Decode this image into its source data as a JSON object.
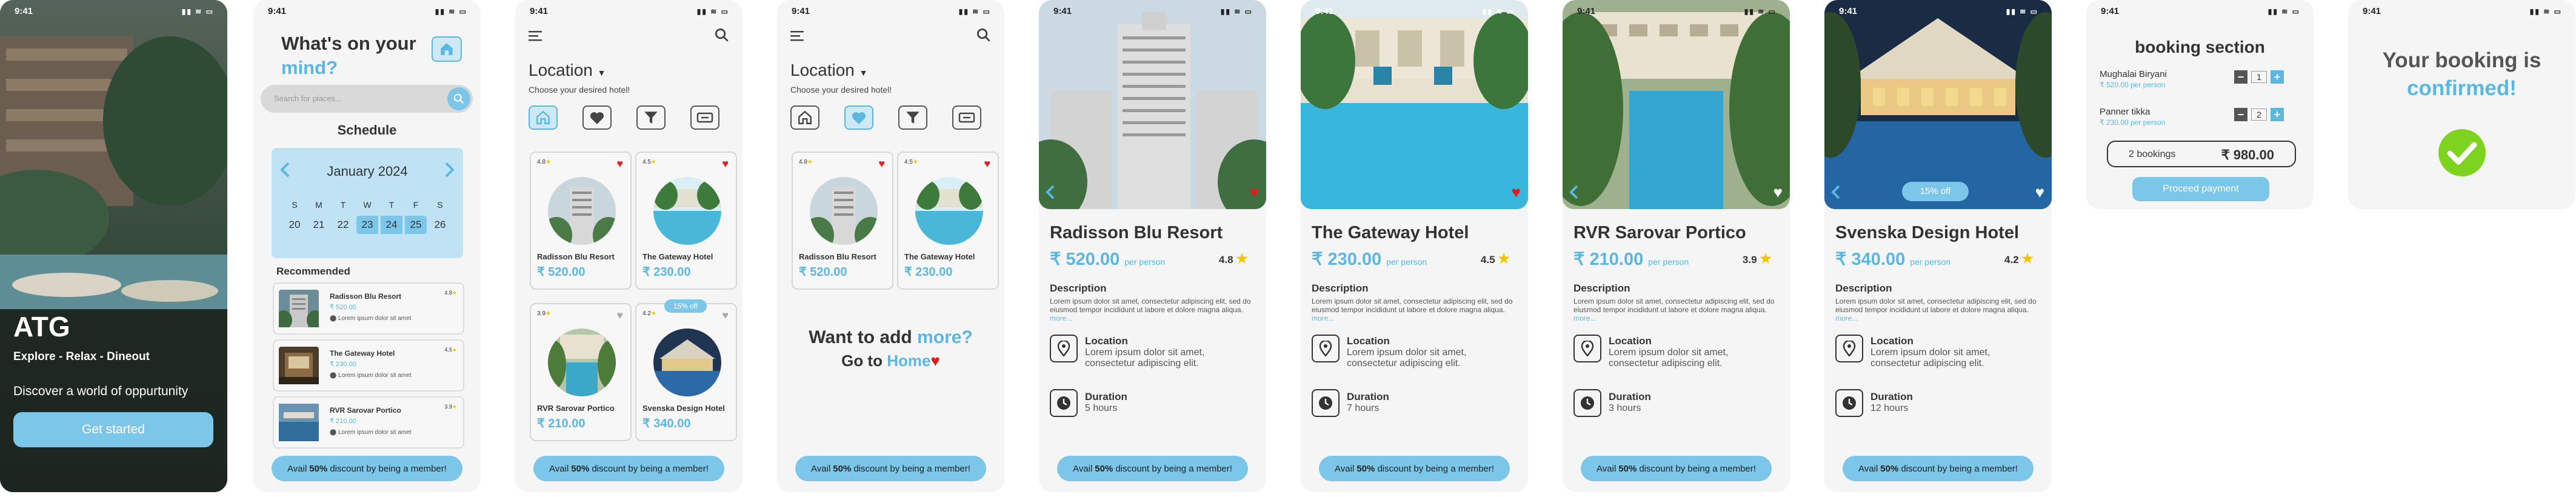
{
  "status_time": "9:41",
  "colors": {
    "accent": "#7cc6ea",
    "accent_text": "#5bb6e0",
    "heart": "#e21b1b",
    "star": "#f2c500",
    "check": "#7ed321"
  },
  "s1": {
    "title": "ATG",
    "tagline": "Explore - Relax - Dineout",
    "subtitle": "Discover a world of oppurtunity",
    "button": "Get started"
  },
  "s2": {
    "headline1": "What's on your",
    "headline2": "mind?",
    "search_placeholder": "Search for places...",
    "schedule": "Schedule",
    "month": "January 2024",
    "weekdays": [
      "S",
      "M",
      "T",
      "W",
      "T",
      "F",
      "S"
    ],
    "days": [
      "20",
      "21",
      "22",
      "23",
      "24",
      "25",
      "26"
    ],
    "recommended": "Recommended",
    "items": [
      {
        "name": "Radisson Blu Resort",
        "price": "₹ 520.00",
        "addr": "Lorem ipsum dolor sit amet",
        "rating": "4.8"
      },
      {
        "name": "The Gateway Hotel",
        "price": "₹ 230.00",
        "addr": "Lorem ipsum dolor sit amet",
        "rating": "4.5"
      },
      {
        "name": "RVR Sarovar Portico",
        "price": "₹ 210.00",
        "addr": "Lorem ipsum dolor sit amet",
        "rating": "3.9"
      }
    ],
    "discount": {
      "pre": "Avail",
      "bold": "50%",
      "post": "discount by being a member!"
    }
  },
  "s3": {
    "location": "Location",
    "choose": "Choose your desired hotel!",
    "cards": [
      {
        "name": "Radisson Blu Resort",
        "price": "₹ 520.00",
        "rating": "4.8"
      },
      {
        "name": "The Gateway Hotel",
        "price": "₹ 230.00",
        "rating": "4.5"
      },
      {
        "name": "RVR Sarovar Portico",
        "price": "₹ 210.00",
        "rating": "3.9"
      },
      {
        "name": "Svenska Design Hotel",
        "price": "₹ 340.00",
        "rating": "4.2",
        "badge": "15% off"
      }
    ]
  },
  "s4": {
    "cards": [
      {
        "name": "Radisson Blu Resort",
        "price": "₹ 520.00",
        "rating": "4.8"
      },
      {
        "name": "The Gateway Hotel",
        "price": "₹ 230.00",
        "rating": "4.5"
      }
    ],
    "want1": "Want to add",
    "want2": "more?",
    "goto1": "Go to",
    "goto2": "Home"
  },
  "details": [
    {
      "name": "Radisson Blu Resort",
      "price": "₹ 520.00",
      "per": "per person",
      "rating": "4.8",
      "duration": "5 hours",
      "liked": true,
      "badge": ""
    },
    {
      "name": "The Gateway Hotel",
      "price": "₹ 230.00",
      "per": "per person",
      "rating": "4.5",
      "duration": "7 hours",
      "liked": true,
      "badge": ""
    },
    {
      "name": "RVR Sarovar Portico",
      "price": "₹ 210.00",
      "per": "per person",
      "rating": "3.9",
      "duration": "3 hours",
      "liked": false,
      "badge": ""
    },
    {
      "name": "Svenska Design Hotel",
      "price": "₹ 340.00",
      "per": "per person",
      "rating": "4.2",
      "duration": "12 hours",
      "liked": false,
      "badge": "15% off"
    }
  ],
  "detail_common": {
    "description_label": "Description",
    "description": "Lorem ipsum dolor sit amet, consectetur adipiscing elit, sed do eiusmod tempor incididunt ut labore et dolore magna aliqua.",
    "more": "more...",
    "location_label": "Location",
    "location_text": "Lorem ipsum dolor sit amet, consectetur adipiscing elit.",
    "duration_label": "Duration"
  },
  "booking": {
    "title": "booking section",
    "items": [
      {
        "name": "Mughalai Biryani",
        "price": "₹ 520.00 per person",
        "qty": "1"
      },
      {
        "name": "Panner tikka",
        "price": "₹ 230.00 per person",
        "qty": "2"
      }
    ],
    "count": "2 bookings",
    "total": "₹ 980.00",
    "button": "Proceed payment"
  },
  "confirm": {
    "line1": "Your booking is",
    "line2": "confirmed!"
  }
}
